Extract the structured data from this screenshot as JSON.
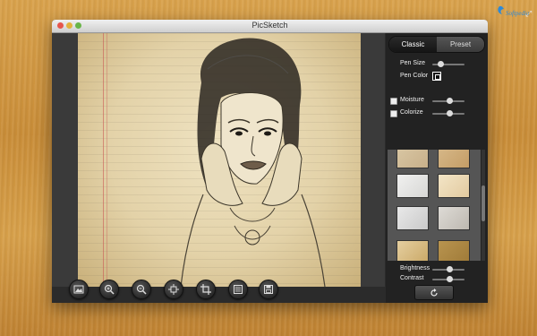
{
  "window": {
    "title": "PicSketch"
  },
  "sidebar": {
    "tabs": [
      {
        "label": "Classic",
        "active": true
      },
      {
        "label": "Preset",
        "active": false
      }
    ],
    "pen_size_label": "Pen Size",
    "pen_color_label": "Pen Color",
    "moisture_label": "Moisture",
    "colorize_label": "Colorize",
    "brightness_label": "Brightness",
    "contrast_label": "Contrast"
  },
  "toolbar": {
    "icons": [
      "image-icon",
      "zoom-in-icon",
      "zoom-out-icon",
      "fit-icon",
      "crop-icon",
      "frame-icon",
      "save-icon"
    ]
  },
  "branding": {
    "logo": "Softpedia"
  },
  "colors": {
    "accent": "#2e8ad8",
    "panel": "#222222",
    "paper": "#e8d9b3"
  }
}
